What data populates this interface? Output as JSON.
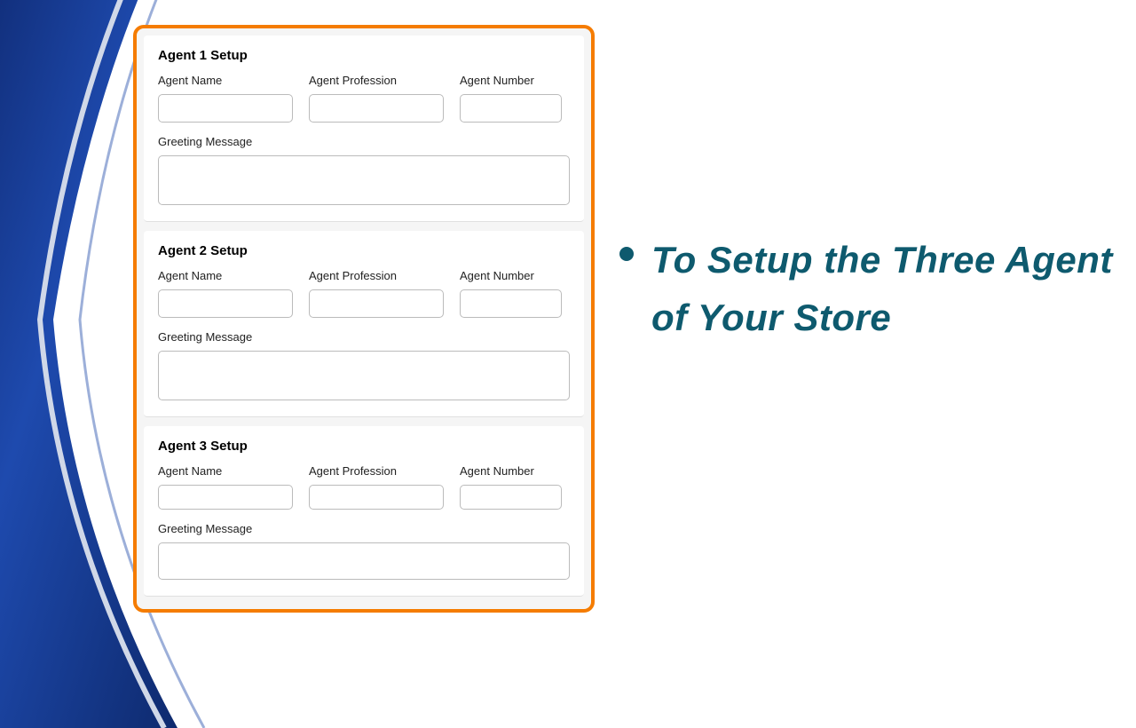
{
  "agents": [
    {
      "title": "Agent 1 Setup",
      "nameLabel": "Agent Name",
      "nameValue": "",
      "professionLabel": "Agent Profession",
      "professionValue": "",
      "numberLabel": "Agent Number",
      "numberValue": "",
      "greetingLabel": "Greeting Message",
      "greetingValue": ""
    },
    {
      "title": "Agent 2 Setup",
      "nameLabel": "Agent Name",
      "nameValue": "",
      "professionLabel": "Agent Profession",
      "professionValue": "",
      "numberLabel": "Agent Number",
      "numberValue": "",
      "greetingLabel": "Greeting Message",
      "greetingValue": ""
    },
    {
      "title": "Agent 3 Setup",
      "nameLabel": "Agent Name",
      "nameValue": "",
      "professionLabel": "Agent Profession",
      "professionValue": "",
      "numberLabel": "Agent Number",
      "numberValue": "",
      "greetingLabel": "Greeting Message",
      "greetingValue": ""
    }
  ],
  "infoText": "To Setup the Three Agent of Your Store",
  "colors": {
    "highlight": "#f57c00",
    "infoText": "#0e5a6e",
    "bgDark": "#0e2a6e",
    "bgLight": "#1e4aae"
  }
}
